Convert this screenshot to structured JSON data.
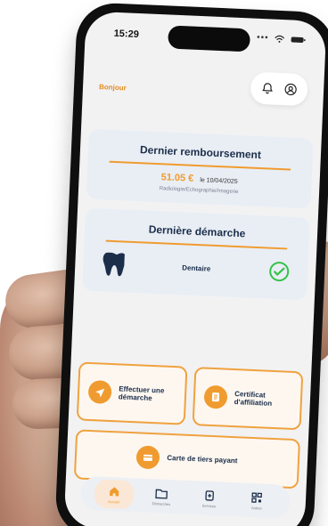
{
  "status": {
    "time": "15:29"
  },
  "header": {
    "greeting": "Bonjour",
    "icons": [
      "bell-icon",
      "account-icon"
    ]
  },
  "cards": {
    "dernier_remboursement": {
      "title": "Dernier remboursement",
      "amount": "51.05 €",
      "date_text": "le 10/04/2025",
      "subtext": "Radiologie/Echographie/Imagerie"
    },
    "derniere_demarche": {
      "title": "Dernière démarche",
      "label": "Dentaire",
      "icons": [
        "tooth-icon",
        "check-circle-icon"
      ]
    }
  },
  "actions": {
    "effectuer": {
      "label": "Effectuer une démarche",
      "icon": "send-icon"
    },
    "certificat": {
      "label": "Certificat d'affiliation",
      "icon": "document-icon"
    },
    "carte": {
      "label": "Carte de tiers payant",
      "icon": "card-icon"
    }
  },
  "bottom_nav": {
    "items": [
      {
        "label": "Accueil",
        "icon": "home-icon",
        "active": true
      },
      {
        "label": "Démarches",
        "icon": "folder-icon",
        "active": false
      },
      {
        "label": "Services",
        "icon": "add-document-icon",
        "active": false
      },
      {
        "label": "Autres",
        "icon": "qr-icon",
        "active": false
      }
    ]
  },
  "colors": {
    "accent": "#f09b2f",
    "card_bg": "#e9eef5",
    "text_dark": "#1b2e4a",
    "success": "#36c24a"
  }
}
